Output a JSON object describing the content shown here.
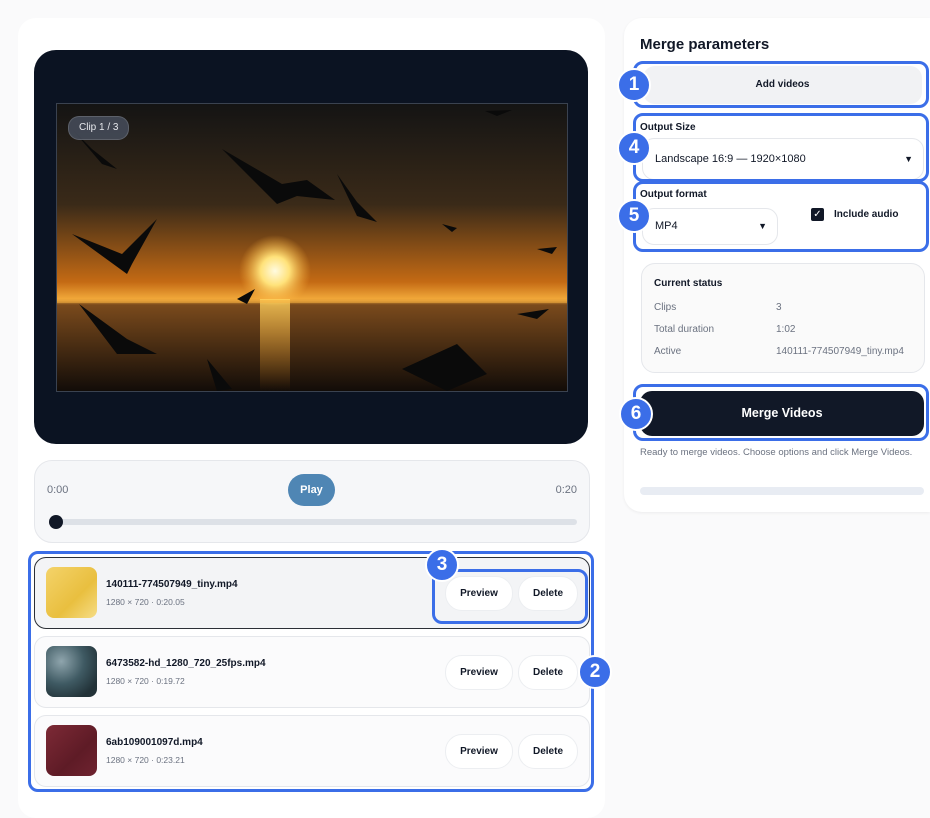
{
  "player": {
    "clip_badge": "Clip 1 / 3",
    "time_start": "0:00",
    "time_end": "0:20",
    "play_label": "Play",
    "progress": 0
  },
  "clips": [
    {
      "name": "140111-774507949_tiny.mp4",
      "meta": "1280 × 720 · 0:20.05",
      "preview_label": "Preview",
      "delete_label": "Delete",
      "selected": true
    },
    {
      "name": "6473582-hd_1280_720_25fps.mp4",
      "meta": "1280 × 720 · 0:19.72",
      "preview_label": "Preview",
      "delete_label": "Delete"
    },
    {
      "name": "6ab109001097d.mp4",
      "meta": "1280 × 720 · 0:23.21",
      "preview_label": "Preview",
      "delete_label": "Delete"
    }
  ],
  "merge": {
    "title": "Merge parameters",
    "add_videos_label": "Add videos",
    "output_size_label": "Output Size",
    "output_size_value": "Landscape 16:9 — 1920×1080",
    "output_format_label": "Output format",
    "output_format_value": "MP4",
    "include_audio_label": "Include audio",
    "include_audio_checked": true,
    "status": {
      "title": "Current status",
      "clips_label": "Clips",
      "clips_value": "3",
      "duration_label": "Total duration",
      "duration_value": "1:02",
      "active_label": "Active",
      "active_value": "140111-774507949_tiny.mp4"
    },
    "merge_button_label": "Merge Videos",
    "help_text": "Ready to merge videos. Choose options and click Merge Videos.",
    "progress": 0
  },
  "annotations": [
    "1",
    "2",
    "3",
    "4",
    "5",
    "6"
  ],
  "colors": {
    "accent": "#3b6ee8",
    "dark": "#111827",
    "play": "#4f86b4"
  }
}
